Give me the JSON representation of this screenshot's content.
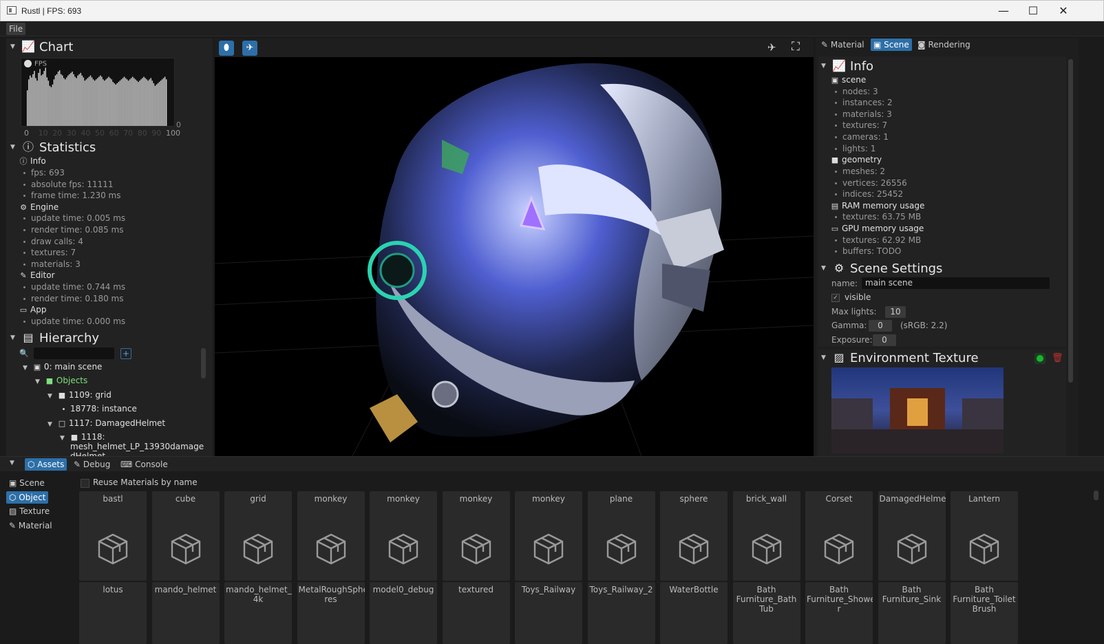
{
  "window": {
    "title": "Rustl | FPS: 693",
    "minimize": "—",
    "maximize": "☐",
    "close": "✕"
  },
  "menu": {
    "file": "File"
  },
  "chart": {
    "title": "Chart",
    "legend": "FPS",
    "y_right_label": "0",
    "x_ticks": [
      "0",
      "10",
      "20",
      "30",
      "40",
      "50",
      "60",
      "70",
      "80",
      "90",
      "100"
    ]
  },
  "chart_data": {
    "type": "bar",
    "title": "",
    "series": [
      {
        "name": "FPS",
        "values": [
          0.55,
          0.72,
          0.78,
          0.75,
          0.8,
          0.85,
          0.74,
          0.7,
          0.82,
          0.88,
          0.78,
          0.8,
          0.85,
          0.9,
          0.75,
          0.7,
          0.62,
          0.6,
          0.64,
          0.72,
          0.78,
          0.8,
          0.84,
          0.86,
          0.8,
          0.78,
          0.74,
          0.72,
          0.75,
          0.78,
          0.8,
          0.82,
          0.84,
          0.8,
          0.76,
          0.74,
          0.78,
          0.8,
          0.82,
          0.78,
          0.75,
          0.7,
          0.72,
          0.74,
          0.76,
          0.78,
          0.75,
          0.72,
          0.7,
          0.72,
          0.74,
          0.76,
          0.78,
          0.76,
          0.72,
          0.7,
          0.72,
          0.74,
          0.76,
          0.74,
          0.72,
          0.68,
          0.66,
          0.64,
          0.66,
          0.68,
          0.7,
          0.72,
          0.74,
          0.76,
          0.74,
          0.72,
          0.7,
          0.72,
          0.74,
          0.76,
          0.74,
          0.72,
          0.7,
          0.68,
          0.7,
          0.72,
          0.74,
          0.76,
          0.74,
          0.72,
          0.7,
          0.72,
          0.74,
          0.7,
          0.66,
          0.62,
          0.64,
          0.66,
          0.68,
          0.7,
          0.72,
          0.74,
          0.76,
          0.72
        ]
      }
    ],
    "xlim": [
      0,
      100
    ]
  },
  "statistics": {
    "title": "Statistics",
    "info_label": "Info",
    "info": [
      "fps: 693",
      "absolute fps: 11111",
      "frame time: 1.230 ms"
    ],
    "engine_label": "Engine",
    "engine": [
      "update time: 0.005 ms",
      "render time: 0.085 ms",
      "draw calls: 4",
      "textures: 7",
      "materials: 3"
    ],
    "editor_label": "Editor",
    "editor": [
      "update time: 0.744 ms",
      "render time: 0.180 ms"
    ],
    "app_label": "App",
    "app": [
      "update time: 0.000 ms"
    ]
  },
  "hierarchy": {
    "title": "Hierarchy",
    "search_value": "",
    "nodes": [
      "0: main scene",
      "Objects",
      "1109: grid",
      "18778: instance",
      "1117: DamagedHelmet",
      "1118:",
      "mesh_helmet_LP_13930damage",
      "dHelmet"
    ]
  },
  "right_tabs": {
    "material": "Material",
    "scene": "Scene",
    "rendering": "Rendering"
  },
  "info": {
    "title": "Info",
    "scene_label": "scene",
    "scene": [
      "nodes: 3",
      "instances: 2",
      "materials: 3",
      "textures: 7",
      "cameras: 1",
      "lights: 1"
    ],
    "geometry_label": "geometry",
    "geometry": [
      "meshes: 2",
      "vertices: 26556",
      "indices: 25452"
    ],
    "ram_label": "RAM memory usage",
    "ram": [
      "textures: 63.75 MB"
    ],
    "gpu_label": "GPU memory usage",
    "gpu": [
      "textures: 62.92 MB",
      "buffers: TODO"
    ]
  },
  "scene_settings": {
    "title": "Scene Settings",
    "name_label": "name:",
    "name_value": "main scene",
    "visible_label": "visible",
    "max_lights_label": "Max lights:",
    "max_lights": "10",
    "gamma_label": "Gamma:",
    "gamma": "0",
    "gamma_note": "(sRGB: 2.2)",
    "exposure_label": "Exposure:",
    "exposure": "0"
  },
  "env_texture": {
    "title": "Environment Texture"
  },
  "bottom_tabs": {
    "assets": "Assets",
    "debug": "Debug",
    "console": "Console"
  },
  "assets_nav": [
    "Scene",
    "Object",
    "Texture",
    "Material"
  ],
  "reuse_label": "Reuse Materials by name",
  "assets_row1": [
    "bastl",
    "cube",
    "grid",
    "monkey",
    "monkey",
    "monkey",
    "monkey",
    "plane",
    "sphere",
    "brick_wall",
    "Corset",
    "DamagedHelmet",
    "Lantern"
  ],
  "assets_row2": [
    "lotus",
    "mando_helmet",
    "mando_helmet_\n4k",
    "MetalRoughSphe\nres",
    "model0_debug",
    "textured",
    "Toys_Railway",
    "Toys_Railway_2",
    "WaterBottle",
    "Bath\nFurniture_Bath\nTub",
    "Bath\nFurniture_Showe\nr",
    "Bath\nFurniture_Sink",
    "Bath\nFurniture_Toilet\nBrush"
  ],
  "colors": {
    "accent": "#2d6fa8",
    "objects_green": "#7ee07e",
    "active_green": "#16b52b",
    "delete_red": "#c03030"
  }
}
